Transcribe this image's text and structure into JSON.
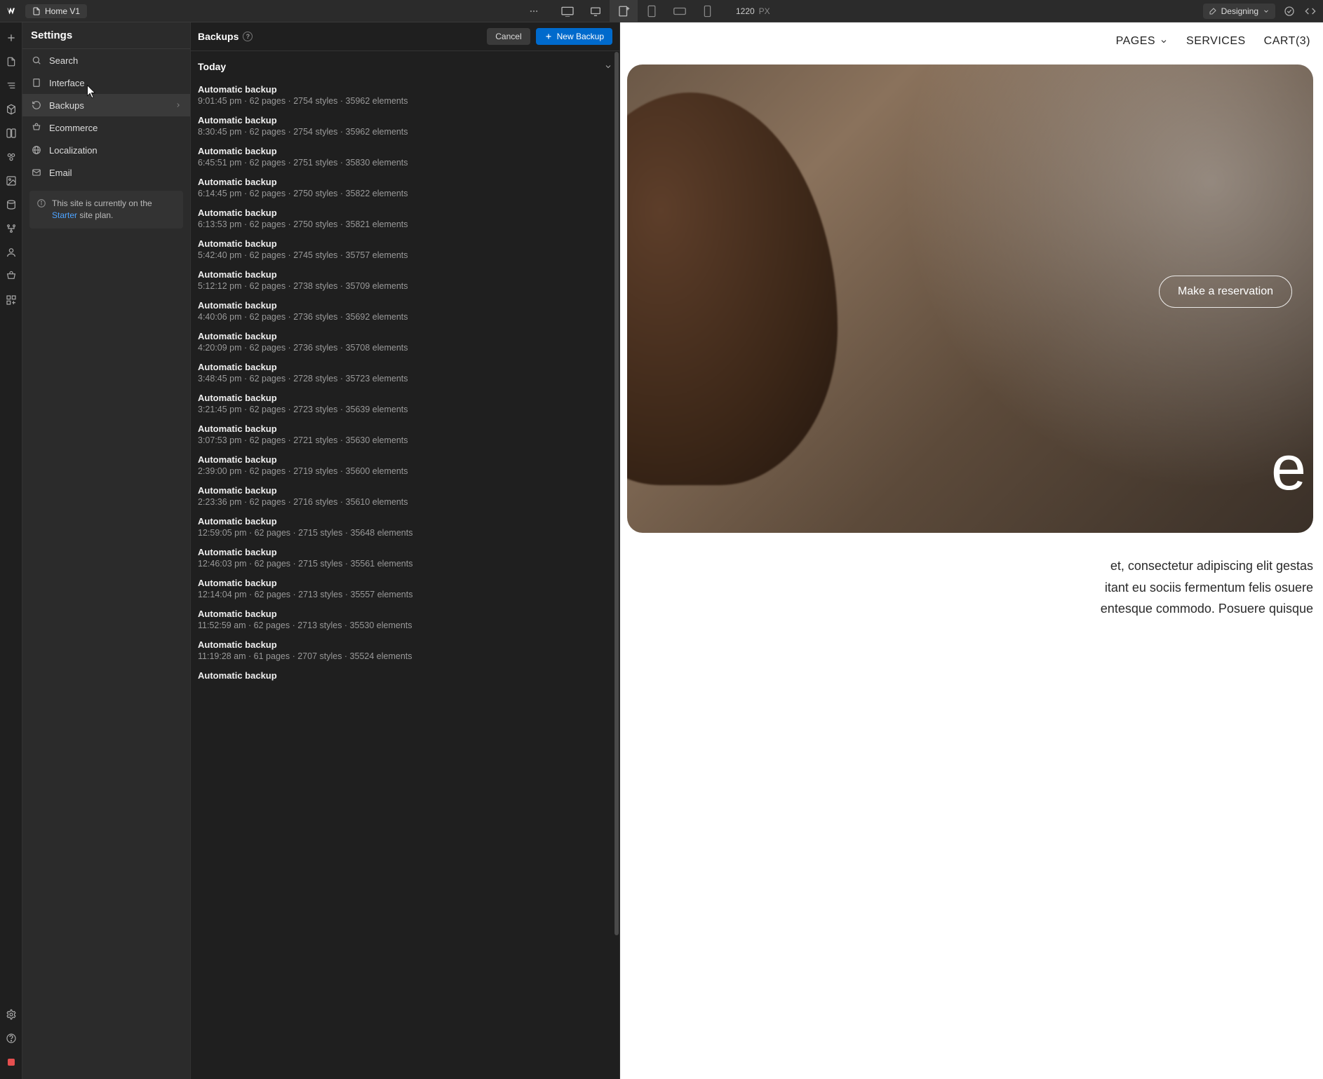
{
  "topbar": {
    "page_name": "Home V1",
    "breakpoint_value": "1220",
    "breakpoint_unit": "PX",
    "mode_label": "Designing"
  },
  "settings": {
    "title": "Settings",
    "items": [
      {
        "label": "Search",
        "icon": "search"
      },
      {
        "label": "Interface",
        "icon": "interface"
      },
      {
        "label": "Backups",
        "icon": "backup",
        "active": true,
        "chevron": true
      },
      {
        "label": "Ecommerce",
        "icon": "cart"
      },
      {
        "label": "Localization",
        "icon": "globe"
      },
      {
        "label": "Email",
        "icon": "mail"
      }
    ],
    "plan_notice_prefix": "This site is currently on the ",
    "plan_notice_link": "Starter",
    "plan_notice_suffix": " site plan."
  },
  "backups": {
    "title": "Backups",
    "cancel_label": "Cancel",
    "new_backup_label": "New Backup",
    "group_label": "Today",
    "items": [
      {
        "title": "Automatic backup",
        "meta": "9:01:45 pm · 62 pages · 2754 styles · 35962 elements"
      },
      {
        "title": "Automatic backup",
        "meta": "8:30:45 pm · 62 pages · 2754 styles · 35962 elements"
      },
      {
        "title": "Automatic backup",
        "meta": "6:45:51 pm · 62 pages · 2751 styles · 35830 elements"
      },
      {
        "title": "Automatic backup",
        "meta": "6:14:45 pm · 62 pages · 2750 styles · 35822 elements"
      },
      {
        "title": "Automatic backup",
        "meta": "6:13:53 pm · 62 pages · 2750 styles · 35821 elements"
      },
      {
        "title": "Automatic backup",
        "meta": "5:42:40 pm · 62 pages · 2745 styles · 35757 elements"
      },
      {
        "title": "Automatic backup",
        "meta": "5:12:12 pm · 62 pages · 2738 styles · 35709 elements"
      },
      {
        "title": "Automatic backup",
        "meta": "4:40:06 pm · 62 pages · 2736 styles · 35692 elements"
      },
      {
        "title": "Automatic backup",
        "meta": "4:20:09 pm · 62 pages · 2736 styles · 35708 elements"
      },
      {
        "title": "Automatic backup",
        "meta": "3:48:45 pm · 62 pages · 2728 styles · 35723 elements"
      },
      {
        "title": "Automatic backup",
        "meta": "3:21:45 pm · 62 pages · 2723 styles · 35639 elements"
      },
      {
        "title": "Automatic backup",
        "meta": "3:07:53 pm · 62 pages · 2721 styles · 35630 elements"
      },
      {
        "title": "Automatic backup",
        "meta": "2:39:00 pm · 62 pages · 2719 styles · 35600 elements"
      },
      {
        "title": "Automatic backup",
        "meta": "2:23:36 pm · 62 pages · 2716 styles · 35610 elements"
      },
      {
        "title": "Automatic backup",
        "meta": "12:59:05 pm · 62 pages · 2715 styles · 35648 elements"
      },
      {
        "title": "Automatic backup",
        "meta": "12:46:03 pm · 62 pages · 2715 styles · 35561 elements"
      },
      {
        "title": "Automatic backup",
        "meta": "12:14:04 pm · 62 pages · 2713 styles · 35557 elements"
      },
      {
        "title": "Automatic backup",
        "meta": "11:52:59 am · 62 pages · 2713 styles · 35530 elements"
      },
      {
        "title": "Automatic backup",
        "meta": "11:19:28 am · 61 pages · 2707 styles · 35524 elements"
      },
      {
        "title": "Automatic backup",
        "meta": ""
      }
    ]
  },
  "site": {
    "nav": {
      "pages": "PAGES",
      "services": "SERVICES",
      "cart": "CART(3)"
    },
    "hero_word_fragment": "e",
    "reserve_label": "Make a reservation",
    "body_line1": "et, consectetur adipiscing elit gestas",
    "body_line2": "itant eu sociis fermentum felis osuere",
    "body_line3": "entesque commodo. Posuere quisque"
  }
}
